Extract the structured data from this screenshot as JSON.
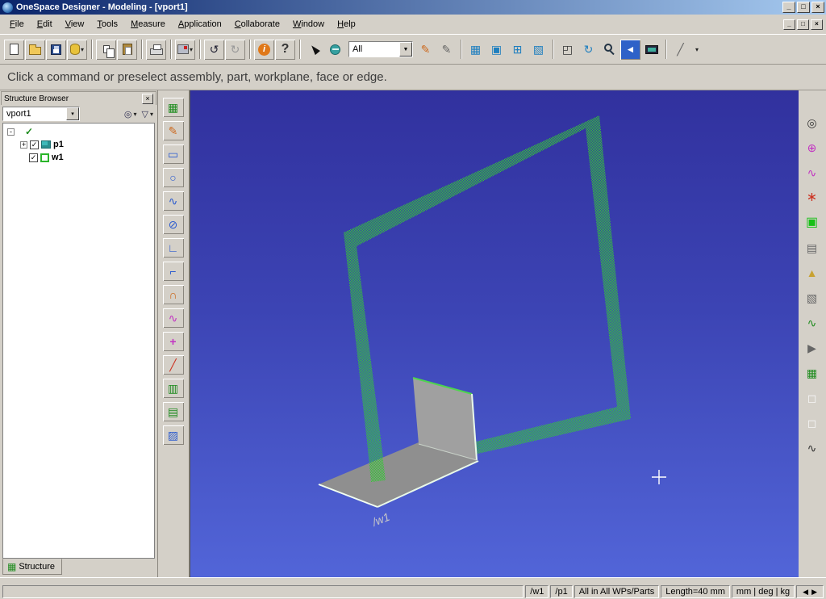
{
  "titlebar": {
    "title": "OneSpace Designer - Modeling - [vport1]"
  },
  "glyphs": {
    "minimize": "_",
    "maximize": "□",
    "close": "×",
    "dropdown": "▼",
    "dropdown_small": "▾",
    "undo": "↺",
    "redo": "↻",
    "info": "i",
    "help": "?",
    "back": "◄",
    "check": "✓",
    "expand": "+",
    "collapse": "-",
    "find": "◎",
    "filter": "▽",
    "nav_left": "◀",
    "nav_right": "▶",
    "grid": "▦",
    "framed_square": "▣",
    "plus_square": "⊞",
    "hatch_square": "▧",
    "window_select": "◰",
    "measure_line": "╱"
  },
  "menubar": {
    "items": [
      "File",
      "Edit",
      "View",
      "Tools",
      "Measure",
      "Application",
      "Collaborate",
      "Window",
      "Help"
    ]
  },
  "toolbar": {
    "filter_value": "All"
  },
  "prompt": {
    "text": "Click a command or preselect assembly, part, workplane, face or edge."
  },
  "structure_browser": {
    "title": "Structure Browser",
    "root_combo": "vport1",
    "tab": "Structure",
    "tree": {
      "p1_label": "p1",
      "w1_label": "w1"
    }
  },
  "left_toolbar": {
    "icons": [
      {
        "name": "structure",
        "glyph": "▦"
      },
      {
        "name": "sketch",
        "glyph": "✎"
      },
      {
        "name": "rectangle",
        "glyph": "▭"
      },
      {
        "name": "circle",
        "glyph": "○"
      },
      {
        "name": "spline",
        "glyph": "∿"
      },
      {
        "name": "ellipse",
        "glyph": "⊘"
      },
      {
        "name": "corner",
        "glyph": "∟"
      },
      {
        "name": "trim",
        "glyph": "⌐"
      },
      {
        "name": "arc",
        "glyph": "∩"
      },
      {
        "name": "curve",
        "glyph": "∿"
      },
      {
        "name": "point",
        "glyph": "+"
      },
      {
        "name": "line",
        "glyph": "╱"
      },
      {
        "name": "extrude",
        "glyph": "▥"
      },
      {
        "name": "revolve",
        "glyph": "▤"
      },
      {
        "name": "hatch",
        "glyph": "▨"
      }
    ]
  },
  "right_toolbar": {
    "icons": [
      {
        "name": "cylinder",
        "glyph": "◎"
      },
      {
        "name": "axis",
        "glyph": "⊕"
      },
      {
        "name": "curve",
        "glyph": "∿"
      },
      {
        "name": "datum",
        "glyph": "∗"
      },
      {
        "name": "workplane",
        "glyph": "▣"
      },
      {
        "name": "stack",
        "glyph": "▤"
      },
      {
        "name": "cone",
        "glyph": "▲"
      },
      {
        "name": "solid",
        "glyph": "▧"
      },
      {
        "name": "wave",
        "glyph": "∿"
      },
      {
        "name": "pointer",
        "glyph": "▶"
      },
      {
        "name": "mesh",
        "glyph": "▦"
      },
      {
        "name": "note",
        "glyph": "◻"
      },
      {
        "name": "label",
        "glyph": "◻"
      },
      {
        "name": "sketch3d",
        "glyph": "∿"
      }
    ]
  },
  "viewport": {
    "workplane_label": "/w1"
  },
  "statusbar": {
    "workplane": "/w1",
    "part": "/p1",
    "scope": "All in All WPs/Parts",
    "length": "Length=40 mm",
    "units": "mm | deg | kg"
  },
  "colors": {
    "titlebar_left": "#0a246a",
    "titlebar_right": "#a6caf0",
    "chrome": "#d4d0c8",
    "viewport_top": "#31319e",
    "viewport_bottom": "#5265d8",
    "workplane_green": "#35c835",
    "part_gray": "#8f8f8f"
  }
}
